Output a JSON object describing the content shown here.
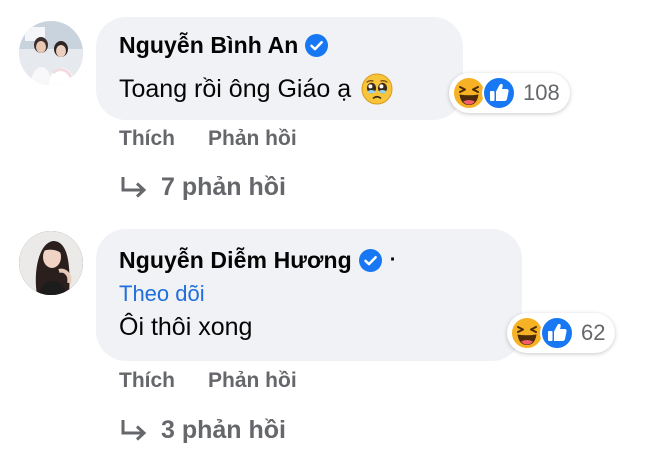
{
  "comments": [
    {
      "author": "Nguyễn Bình An",
      "verified": true,
      "text": "Toang rồi ông Giáo ạ",
      "emoji": "pleading-face-icon",
      "reactions": [
        "haha-icon",
        "like-icon"
      ],
      "reaction_count": "108",
      "actions": {
        "like": "Thích",
        "reply": "Phản hồi"
      },
      "replies_label": "7 phản hồi"
    },
    {
      "author": "Nguyễn Diễm Hương",
      "verified": true,
      "separator": "·",
      "follow_label": "Theo dõi",
      "text": "Ôi thôi xong",
      "reactions": [
        "haha-icon",
        "like-icon"
      ],
      "reaction_count": "62",
      "actions": {
        "like": "Thích",
        "reply": "Phản hồi"
      },
      "replies_label": "3 phản hồi"
    }
  ],
  "colors": {
    "bubble": "#f0f2f5",
    "verified": "#1877f2",
    "link": "#216fdb",
    "secondary_text": "#65676b",
    "haha": "#f7b125",
    "like": "#1877f2"
  }
}
